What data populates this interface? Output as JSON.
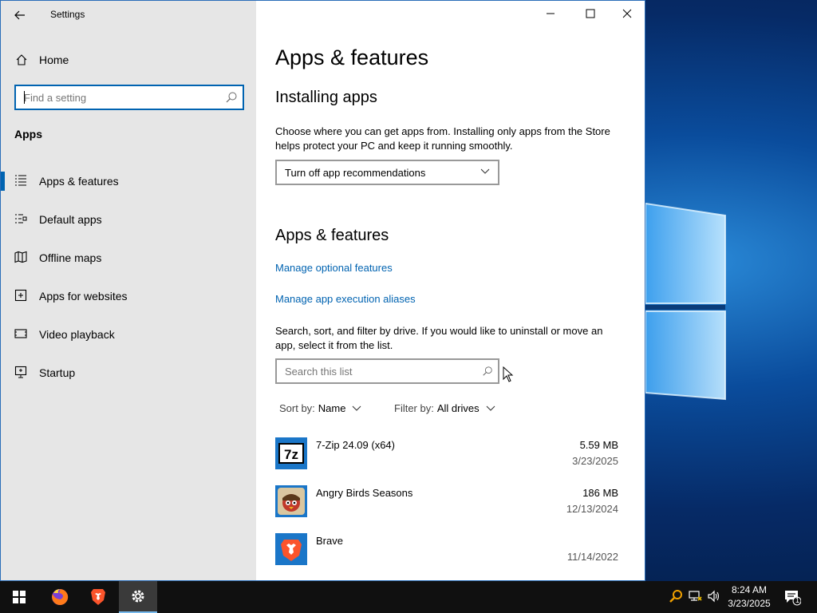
{
  "window": {
    "title": "Settings"
  },
  "sidebar": {
    "home_label": "Home",
    "search_placeholder": "Find a setting",
    "section_label": "Apps",
    "items": [
      {
        "label": "Apps & features",
        "icon": "apps-features-icon",
        "active": true
      },
      {
        "label": "Default apps",
        "icon": "default-apps-icon"
      },
      {
        "label": "Offline maps",
        "icon": "offline-maps-icon"
      },
      {
        "label": "Apps for websites",
        "icon": "apps-for-websites-icon"
      },
      {
        "label": "Video playback",
        "icon": "video-playback-icon"
      },
      {
        "label": "Startup",
        "icon": "startup-icon"
      }
    ]
  },
  "main": {
    "page_title": "Apps & features",
    "installing": {
      "heading": "Installing apps",
      "description": "Choose where you can get apps from. Installing only apps from the Store helps protect your PC and keep it running smoothly.",
      "dropdown_value": "Turn off app recommendations"
    },
    "features": {
      "heading": "Apps & features",
      "link_optional": "Manage optional features",
      "link_aliases": "Manage app execution aliases",
      "description": "Search, sort, and filter by drive. If you would like to uninstall or move an app, select it from the list.",
      "search_placeholder": "Search this list",
      "sort_label": "Sort by:",
      "sort_value": "Name",
      "filter_label": "Filter by:",
      "filter_value": "All drives"
    },
    "apps": [
      {
        "name": "7-Zip 24.09 (x64)",
        "size": "5.59 MB",
        "date": "3/23/2025"
      },
      {
        "name": "Angry Birds Seasons",
        "size": "186 MB",
        "date": "12/13/2024"
      },
      {
        "name": "Brave",
        "size": "",
        "date": "11/14/2022"
      }
    ]
  },
  "taskbar": {
    "time": "8:24 AM",
    "date": "3/23/2025",
    "notification_count": "1"
  },
  "colors": {
    "accent": "#0063b1",
    "sidebar_bg": "#e6e6e6"
  }
}
